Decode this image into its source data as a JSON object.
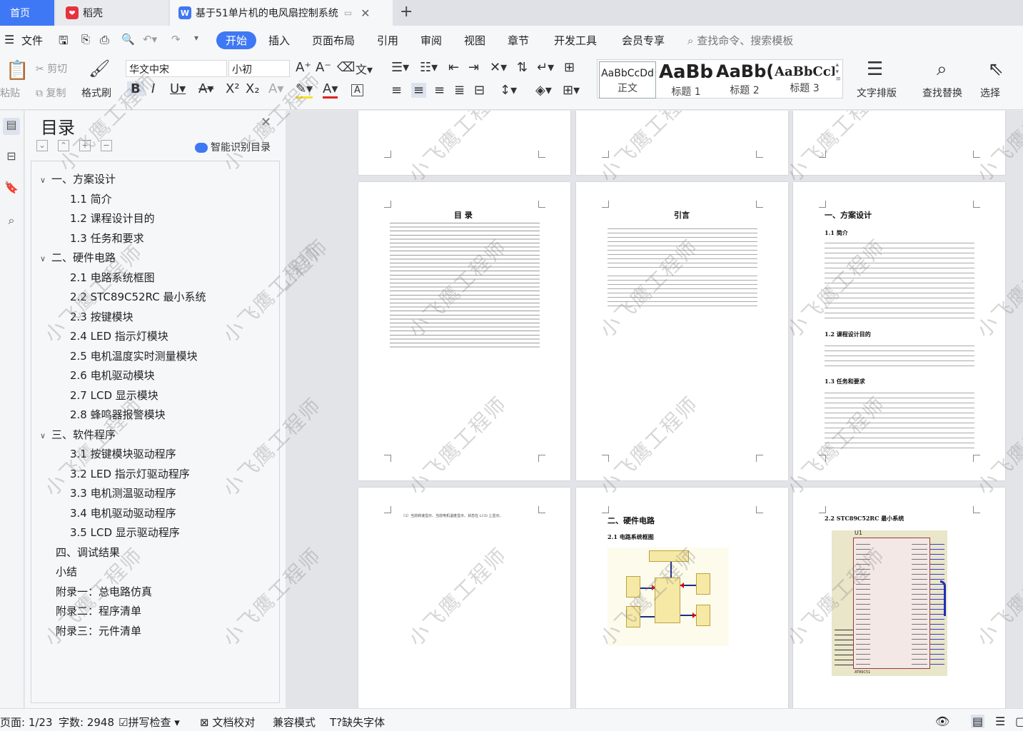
{
  "tabs": {
    "home": "首页",
    "daoke": "稻壳",
    "doc": "基于51单片机的电风扇控制系统"
  },
  "menu": {
    "file": "文件",
    "items": [
      "开始",
      "插入",
      "页面布局",
      "引用",
      "审阅",
      "视图",
      "章节",
      "开发工具",
      "会员专享"
    ],
    "search_placeholder": "查找命令、搜索模板"
  },
  "ribbon": {
    "paste": "粘贴",
    "cut": "剪切",
    "copy": "复制",
    "format_painter": "格式刷",
    "font_name": "华文中宋",
    "font_size": "小初",
    "styles": [
      {
        "sample": "AaBbCcDd",
        "name": "正文"
      },
      {
        "sample": "AaBb",
        "name": "标题 1"
      },
      {
        "sample": "AaBb(",
        "name": "标题 2"
      },
      {
        "sample": "AaBbCcI",
        "name": "标题 3"
      }
    ],
    "text_layout": "文字排版",
    "find_replace": "查找替换",
    "select": "选择"
  },
  "nav": {
    "title": "目录",
    "smart": "智能识别目录",
    "items": [
      "一、方案设计",
      "1.1 简介",
      "1.2 课程设计目的",
      "1.3 任务和要求",
      "二、硬件电路",
      "2.1 电路系统框图",
      "2.2 STC89C52RC 最小系统",
      "2.3  按键模块",
      "2.4 LED 指示灯模块",
      "2.5  电机温度实时测量模块",
      "2.6  电机驱动模块",
      "2.7 LCD 显示模块",
      "2.8  蜂鸣器报警模块",
      "三、软件程序",
      "3.1  按键模块驱动程序",
      "3.2 LED 指示灯驱动程序",
      "3.3  电机测温驱动程序",
      "3.4  电机驱动驱动程序",
      "3.5 LCD 显示驱动程序",
      "四、调试结果",
      "小结",
      "附录一：总电路仿真",
      "附录二：程序清单",
      "附录三：元件清单"
    ]
  },
  "pages": {
    "toc_title": "目  录",
    "intro_title": "引言",
    "ch1_title": "一、方案设计",
    "s11": "1.1 简介",
    "s12": "1.2 课程设计目的",
    "s13": "1.3 任务和要求",
    "ch2_title": "二、硬件电路",
    "s21": "2.1 电路系统框图",
    "s22": "2.2 STC89C52RC 最小系统",
    "p4_line": "（3）当前转速显示、当前电机温度显示、状态在 LCD 上显示。",
    "chip_label": "U1",
    "chip_name": "AT89C51"
  },
  "watermark": "小飞鹰工程师",
  "status": {
    "page": "页面: 1/23",
    "words": "字数: 2948",
    "spell": "拼写检查",
    "proof": "文档校对",
    "compat": "兼容模式",
    "missing_font": "缺失字体"
  }
}
